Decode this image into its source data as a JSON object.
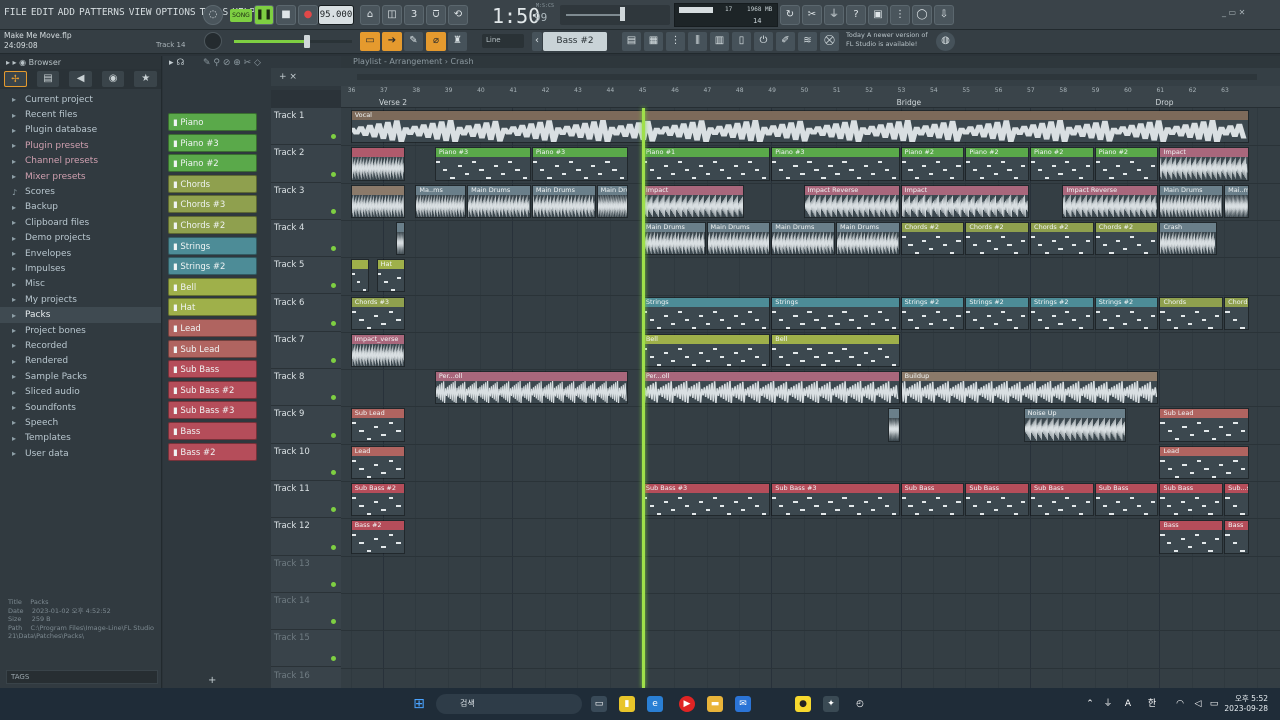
{
  "menu": [
    "FILE",
    "EDIT",
    "ADD",
    "PATTERNS",
    "VIEW",
    "OPTIONS",
    "TOOLS",
    "HELP"
  ],
  "transport": {
    "mode": "SONG",
    "tempo": "95.000",
    "time": "1:50",
    "time_sub": "99",
    "time_label": "M:S:CS",
    "cpu": "17",
    "mem": "1968 MB",
    "poly": "14"
  },
  "project": {
    "name": "Make Me Move.flp",
    "time": "24:09:08",
    "hint": "Track 14"
  },
  "toolbar2": {
    "snap": "Line",
    "pattern": "Bass #2",
    "news": "Today  A newer version of FL Studio is available!"
  },
  "browser": {
    "title": "Browser",
    "items": [
      {
        "label": "Current project",
        "icon": "▸"
      },
      {
        "label": "Recent files",
        "icon": "▸"
      },
      {
        "label": "Plugin database",
        "icon": "▸"
      },
      {
        "label": "Plugin presets",
        "icon": "▸"
      },
      {
        "label": "Channel presets",
        "icon": "▸"
      },
      {
        "label": "Mixer presets",
        "icon": "▸"
      },
      {
        "label": "Scores",
        "icon": "♪"
      },
      {
        "label": "Backup",
        "icon": "▸"
      },
      {
        "label": "Clipboard files",
        "icon": "▸"
      },
      {
        "label": "Demo projects",
        "icon": "▸"
      },
      {
        "label": "Envelopes",
        "icon": "▸"
      },
      {
        "label": "Impulses",
        "icon": "▸"
      },
      {
        "label": "Misc",
        "icon": "▸"
      },
      {
        "label": "My projects",
        "icon": "▸"
      },
      {
        "label": "Packs",
        "icon": "▸"
      },
      {
        "label": "Project bones",
        "icon": "▸"
      },
      {
        "label": "Recorded",
        "icon": "▸"
      },
      {
        "label": "Rendered",
        "icon": "▸"
      },
      {
        "label": "Sample Packs",
        "icon": "▸"
      },
      {
        "label": "Sliced audio",
        "icon": "▸"
      },
      {
        "label": "Soundfonts",
        "icon": "▸"
      },
      {
        "label": "Speech",
        "icon": "▸"
      },
      {
        "label": "Templates",
        "icon": "▸"
      },
      {
        "label": "User data",
        "icon": "▸"
      }
    ],
    "info": {
      "title": "Packs",
      "date": "2023-01-02 오후 4:52:52",
      "size": "259 B",
      "path": "C:\\Program Files\\Image-Line\\FL Studio 21\\Data\\Patches\\Packs\\"
    },
    "tags_label": "TAGS"
  },
  "playlist": {
    "title": "Playlist - Arrangement",
    "crumb": "Crash"
  },
  "channels": [
    {
      "name": "Piano",
      "color": "#5aa94a"
    },
    {
      "name": "Piano #3",
      "color": "#5aa94a"
    },
    {
      "name": "Piano #2",
      "color": "#5aa94a"
    },
    {
      "name": "Chords",
      "color": "#8fa04e"
    },
    {
      "name": "Chords #3",
      "color": "#8fa04e"
    },
    {
      "name": "Chords #2",
      "color": "#8fa04e"
    },
    {
      "name": "Strings",
      "color": "#4d8c97"
    },
    {
      "name": "Strings #2",
      "color": "#4d8c97"
    },
    {
      "name": "Bell",
      "color": "#9fb04a"
    },
    {
      "name": "Hat",
      "color": "#9fb04a"
    },
    {
      "name": "Lead",
      "color": "#b06460"
    },
    {
      "name": "Sub Lead",
      "color": "#b06460"
    },
    {
      "name": "Sub Bass",
      "color": "#b54d5a"
    },
    {
      "name": "Sub Bass #2",
      "color": "#b54d5a"
    },
    {
      "name": "Sub Bass #3",
      "color": "#b54d5a"
    },
    {
      "name": "Bass",
      "color": "#b54d5a"
    },
    {
      "name": "Bass #2",
      "color": "#b54d5a"
    }
  ],
  "tracks": [
    "Track 1",
    "Track 2",
    "Track 3",
    "Track 4",
    "Track 5",
    "Track 6",
    "Track 7",
    "Track 8",
    "Track 9",
    "Track 10",
    "Track 11",
    "Track 12",
    "Track 13",
    "Track 14",
    "Track 15",
    "Track 16"
  ],
  "ruler": {
    "ticks": [
      "36",
      "37",
      "38",
      "39",
      "40",
      "41",
      "42",
      "43",
      "44",
      "45",
      "46",
      "47",
      "48",
      "49",
      "50",
      "51",
      "52",
      "53",
      "54",
      "55",
      "56",
      "57",
      "58",
      "59",
      "60",
      "61",
      "62",
      "63"
    ],
    "markers": [
      {
        "label": "Verse 2",
        "bar": 37
      },
      {
        "label": "Bridge",
        "bar": 53
      },
      {
        "label": "Drop",
        "bar": 61
      }
    ]
  },
  "clips": [
    {
      "track": 0,
      "start": 36,
      "end": 63.8,
      "name": "Vocal",
      "color": "#7d6a5a",
      "kind": "audio"
    },
    {
      "track": 1,
      "start": 36,
      "end": 37.7,
      "name": "",
      "color": "#b05a6c",
      "kind": "audio"
    },
    {
      "track": 1,
      "start": 38.6,
      "end": 41.6,
      "name": "Piano #3",
      "color": "#5aa94a",
      "kind": "notes"
    },
    {
      "track": 1,
      "start": 41.6,
      "end": 44.6,
      "name": "Piano #3",
      "color": "#5aa94a",
      "kind": "notes"
    },
    {
      "track": 1,
      "start": 45,
      "end": 49,
      "name": "Piano #1",
      "color": "#5aa94a",
      "kind": "notes"
    },
    {
      "track": 1,
      "start": 49,
      "end": 53,
      "name": "Piano #3",
      "color": "#5aa94a",
      "kind": "notes"
    },
    {
      "track": 1,
      "start": 53,
      "end": 55,
      "name": "Piano #2",
      "color": "#5aa94a",
      "kind": "notes"
    },
    {
      "track": 1,
      "start": 55,
      "end": 57,
      "name": "Piano #2",
      "color": "#5aa94a",
      "kind": "notes"
    },
    {
      "track": 1,
      "start": 57,
      "end": 59,
      "name": "Piano #2",
      "color": "#5aa94a",
      "kind": "notes"
    },
    {
      "track": 1,
      "start": 59,
      "end": 61,
      "name": "Piano #2",
      "color": "#5aa94a",
      "kind": "notes"
    },
    {
      "track": 1,
      "start": 61,
      "end": 63.8,
      "name": "Impact",
      "color": "#a9677c",
      "kind": "audio"
    },
    {
      "track": 2,
      "start": 36,
      "end": 37.7,
      "name": "",
      "color": "#8b7a6a",
      "kind": "audio"
    },
    {
      "track": 2,
      "start": 38,
      "end": 39.6,
      "name": "Ma..ms",
      "color": "#6a7f8a",
      "kind": "audio"
    },
    {
      "track": 2,
      "start": 39.6,
      "end": 41.6,
      "name": "Main Drums",
      "color": "#6a7f8a",
      "kind": "audio"
    },
    {
      "track": 2,
      "start": 41.6,
      "end": 43.6,
      "name": "Main Drums",
      "color": "#6a7f8a",
      "kind": "audio"
    },
    {
      "track": 2,
      "start": 43.6,
      "end": 44.6,
      "name": "Main Drums",
      "color": "#6a7f8a",
      "kind": "audio"
    },
    {
      "track": 2,
      "start": 45,
      "end": 48.2,
      "name": "Impact",
      "color": "#a9677c",
      "kind": "audio"
    },
    {
      "track": 2,
      "start": 50,
      "end": 53,
      "name": "Impact Reverse",
      "color": "#a9677c",
      "kind": "audio"
    },
    {
      "track": 2,
      "start": 53,
      "end": 57,
      "name": "Impact",
      "color": "#a9677c",
      "kind": "audio"
    },
    {
      "track": 2,
      "start": 58,
      "end": 61,
      "name": "Impact Reverse",
      "color": "#a9677c",
      "kind": "audio"
    },
    {
      "track": 2,
      "start": 61,
      "end": 63,
      "name": "Main Drums",
      "color": "#6a7f8a",
      "kind": "audio"
    },
    {
      "track": 2,
      "start": 63,
      "end": 63.8,
      "name": "Mai..ms",
      "color": "#6a7f8a",
      "kind": "audio"
    },
    {
      "track": 3,
      "start": 37.4,
      "end": 37.7,
      "name": "",
      "color": "#6a7f8a",
      "kind": "audio"
    },
    {
      "track": 3,
      "start": 45,
      "end": 47,
      "name": "Main Drums",
      "color": "#6a7f8a",
      "kind": "audio"
    },
    {
      "track": 3,
      "start": 47,
      "end": 49,
      "name": "Main Drums",
      "color": "#6a7f8a",
      "kind": "audio"
    },
    {
      "track": 3,
      "start": 49,
      "end": 51,
      "name": "Main Drums",
      "color": "#6a7f8a",
      "kind": "audio"
    },
    {
      "track": 3,
      "start": 51,
      "end": 53,
      "name": "Main Drums",
      "color": "#6a7f8a",
      "kind": "audio"
    },
    {
      "track": 3,
      "start": 53,
      "end": 55,
      "name": "Chords #2",
      "color": "#8fa04e",
      "kind": "notes"
    },
    {
      "track": 3,
      "start": 55,
      "end": 57,
      "name": "Chords #2",
      "color": "#8fa04e",
      "kind": "notes"
    },
    {
      "track": 3,
      "start": 57,
      "end": 59,
      "name": "Chords #2",
      "color": "#8fa04e",
      "kind": "notes"
    },
    {
      "track": 3,
      "start": 59,
      "end": 61,
      "name": "Chords #2",
      "color": "#8fa04e",
      "kind": "notes"
    },
    {
      "track": 3,
      "start": 61,
      "end": 62.8,
      "name": "Crash",
      "color": "#6a7f8a",
      "kind": "audio"
    },
    {
      "track": 4,
      "start": 36,
      "end": 36.6,
      "name": "",
      "color": "#9fb04a",
      "kind": "notes"
    },
    {
      "track": 4,
      "start": 36.8,
      "end": 37.7,
      "name": "Hat",
      "color": "#9fb04a",
      "kind": "notes"
    },
    {
      "track": 5,
      "start": 36,
      "end": 37.7,
      "name": "Chords #3",
      "color": "#8fa04e",
      "kind": "notes"
    },
    {
      "track": 5,
      "start": 45,
      "end": 49,
      "name": "Strings",
      "color": "#4d8c97",
      "kind": "notes"
    },
    {
      "track": 5,
      "start": 49,
      "end": 53,
      "name": "Strings",
      "color": "#4d8c97",
      "kind": "notes"
    },
    {
      "track": 5,
      "start": 53,
      "end": 55,
      "name": "Strings #2",
      "color": "#4d8c97",
      "kind": "notes"
    },
    {
      "track": 5,
      "start": 55,
      "end": 57,
      "name": "Strings #2",
      "color": "#4d8c97",
      "kind": "notes"
    },
    {
      "track": 5,
      "start": 57,
      "end": 59,
      "name": "Strings #2",
      "color": "#4d8c97",
      "kind": "notes"
    },
    {
      "track": 5,
      "start": 59,
      "end": 61,
      "name": "Strings #2",
      "color": "#4d8c97",
      "kind": "notes"
    },
    {
      "track": 5,
      "start": 61,
      "end": 63,
      "name": "Chords",
      "color": "#8fa04e",
      "kind": "notes"
    },
    {
      "track": 5,
      "start": 63,
      "end": 63.8,
      "name": "Chords",
      "color": "#8fa04e",
      "kind": "notes"
    },
    {
      "track": 6,
      "start": 36,
      "end": 37.7,
      "name": "Impact_verse",
      "color": "#a9677c",
      "kind": "audio"
    },
    {
      "track": 6,
      "start": 45,
      "end": 49,
      "name": "Bell",
      "color": "#9fb04a",
      "kind": "notes"
    },
    {
      "track": 6,
      "start": 49,
      "end": 53,
      "name": "Bell",
      "color": "#9fb04a",
      "kind": "notes"
    },
    {
      "track": 7,
      "start": 38.6,
      "end": 44.6,
      "name": "Per...oll",
      "color": "#a9677c",
      "kind": "audio"
    },
    {
      "track": 7,
      "start": 45,
      "end": 53,
      "name": "Per...oll",
      "color": "#a9677c",
      "kind": "audio"
    },
    {
      "track": 7,
      "start": 53,
      "end": 61,
      "name": "Buildup",
      "color": "#8b7a6a",
      "kind": "audio"
    },
    {
      "track": 8,
      "start": 36,
      "end": 37.7,
      "name": "Sub Lead",
      "color": "#b06460",
      "kind": "notes"
    },
    {
      "track": 8,
      "start": 52.6,
      "end": 53,
      "name": "",
      "color": "#6a7f8a",
      "kind": "audio"
    },
    {
      "track": 8,
      "start": 56.8,
      "end": 60,
      "name": "Noise Up",
      "color": "#6a7f8a",
      "kind": "audio"
    },
    {
      "track": 8,
      "start": 61,
      "end": 63.8,
      "name": "Sub Lead",
      "color": "#b06460",
      "kind": "notes"
    },
    {
      "track": 9,
      "start": 36,
      "end": 37.7,
      "name": "Lead",
      "color": "#b06460",
      "kind": "notes"
    },
    {
      "track": 9,
      "start": 61,
      "end": 63.8,
      "name": "Lead",
      "color": "#b06460",
      "kind": "notes"
    },
    {
      "track": 10,
      "start": 36,
      "end": 37.7,
      "name": "Sub Bass #2",
      "color": "#b54d5a",
      "kind": "notes"
    },
    {
      "track": 10,
      "start": 45,
      "end": 49,
      "name": "Sub Bass #3",
      "color": "#b54d5a",
      "kind": "notes"
    },
    {
      "track": 10,
      "start": 49,
      "end": 53,
      "name": "Sub Bass #3",
      "color": "#b54d5a",
      "kind": "notes"
    },
    {
      "track": 10,
      "start": 53,
      "end": 55,
      "name": "Sub Bass",
      "color": "#b54d5a",
      "kind": "notes"
    },
    {
      "track": 10,
      "start": 55,
      "end": 57,
      "name": "Sub Bass",
      "color": "#b54d5a",
      "kind": "notes"
    },
    {
      "track": 10,
      "start": 57,
      "end": 59,
      "name": "Sub Bass",
      "color": "#b54d5a",
      "kind": "notes"
    },
    {
      "track": 10,
      "start": 59,
      "end": 61,
      "name": "Sub Bass",
      "color": "#b54d5a",
      "kind": "notes"
    },
    {
      "track": 10,
      "start": 61,
      "end": 63,
      "name": "Sub Bass",
      "color": "#b54d5a",
      "kind": "notes"
    },
    {
      "track": 10,
      "start": 63,
      "end": 63.8,
      "name": "Sub...ss",
      "color": "#b54d5a",
      "kind": "notes"
    },
    {
      "track": 11,
      "start": 36,
      "end": 37.7,
      "name": "Bass #2",
      "color": "#b54d5a",
      "kind": "notes"
    },
    {
      "track": 11,
      "start": 61,
      "end": 63,
      "name": "Bass",
      "color": "#b54d5a",
      "kind": "notes"
    },
    {
      "track": 11,
      "start": 63,
      "end": 63.8,
      "name": "Bass",
      "color": "#b54d5a",
      "kind": "notes"
    }
  ],
  "playhead_bar": 45,
  "taskbar": {
    "search": "검색",
    "time": "오후 5:52",
    "date": "2023-09-28",
    "lang": "A",
    "ime": "한"
  }
}
